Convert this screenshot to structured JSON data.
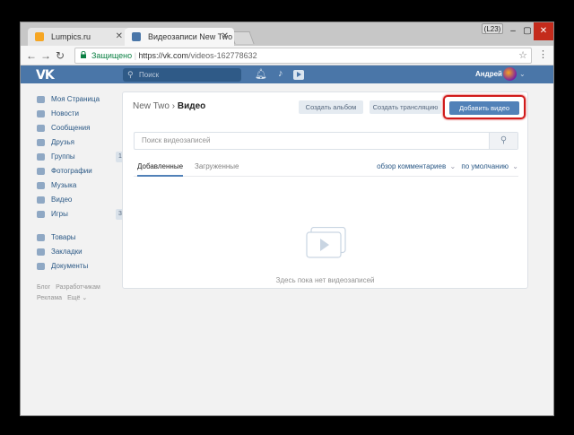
{
  "browser": {
    "tabs": [
      {
        "title": "Lumpics.ru",
        "favicon_color": "#f6a623"
      },
      {
        "title": "Видеозаписи New Two",
        "favicon_color": "#4a76a8"
      }
    ],
    "user_badge": "(L23)",
    "address": {
      "secure_label": "Защищено",
      "url_host": "https://vk.com",
      "url_path": "/videos-162778632"
    }
  },
  "vk_header": {
    "logo": "VK",
    "search_placeholder": "Поиск",
    "username": "Андрей"
  },
  "sidebar": {
    "items": [
      {
        "label": "Моя Страница",
        "badge": ""
      },
      {
        "label": "Новости",
        "badge": ""
      },
      {
        "label": "Сообщения",
        "badge": ""
      },
      {
        "label": "Друзья",
        "badge": ""
      },
      {
        "label": "Группы",
        "badge": "1"
      },
      {
        "label": "Фотографии",
        "badge": ""
      },
      {
        "label": "Музыка",
        "badge": ""
      },
      {
        "label": "Видео",
        "badge": ""
      },
      {
        "label": "Игры",
        "badge": "3"
      }
    ],
    "items2": [
      {
        "label": "Товары"
      },
      {
        "label": "Закладки"
      },
      {
        "label": "Документы"
      }
    ],
    "footer": [
      "Блог",
      "Разработчикам",
      "Реклама",
      "Ещё ⌄"
    ]
  },
  "page": {
    "breadcrumb_group": "New Two",
    "breadcrumb_sep": "›",
    "breadcrumb_current": "Видео",
    "btn_album": "Создать альбом",
    "btn_stream": "Создать трансляцию",
    "btn_add": "Добавить видео",
    "search_placeholder": "Поиск видеозаписей",
    "tab_added": "Добавленные",
    "tab_uploaded": "Загруженные",
    "link_comments": "обзор комментариев",
    "sort_label": "по умолчанию",
    "empty_text": "Здесь пока нет видеозаписей"
  }
}
